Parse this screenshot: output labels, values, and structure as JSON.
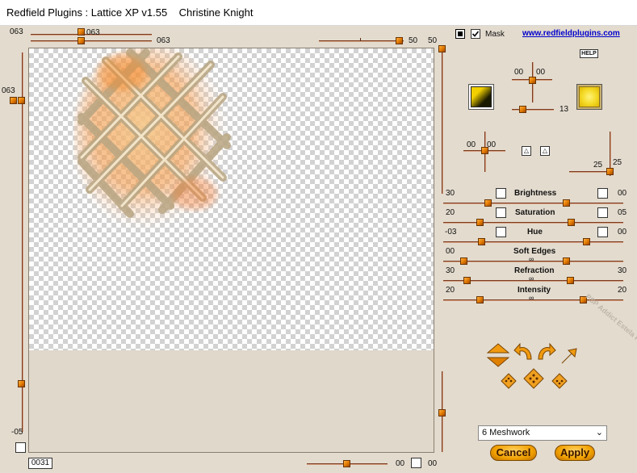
{
  "window": {
    "title": "Redfield Plugins : Lattice XP v1.55    Christine Knight"
  },
  "top_sliders": {
    "left_label": "063",
    "upper_knob_label": "063",
    "lower_value": "063",
    "right_value_a": "50",
    "right_value_b": "50"
  },
  "left_slider": {
    "top_value": "063",
    "bottom_value": "-05"
  },
  "mask": {
    "label": "Mask",
    "checked": true
  },
  "link": "www.redfieldplugins.com",
  "help_label": "HELP",
  "light": {
    "cross_top": "00",
    "cross_right": "00",
    "slider_value": "13"
  },
  "bevel": {
    "cross_value_top": "00",
    "cross_value_left": "00",
    "value_a": "25",
    "value_b": "25"
  },
  "adjustments": [
    {
      "name": "Brightness",
      "left": "30",
      "right": "00"
    },
    {
      "name": "Saturation",
      "left": "20",
      "right": "05"
    },
    {
      "name": "Hue",
      "left": "-03",
      "right": "00"
    },
    {
      "name": "Soft Edges",
      "left": "00",
      "right": ""
    },
    {
      "name": "Refraction",
      "left": "30",
      "right": "30"
    },
    {
      "name": "Intensity",
      "left": "20",
      "right": "20"
    }
  ],
  "preset": {
    "selected": "6 Meshwork"
  },
  "buttons": {
    "cancel": "Cancel",
    "apply": "Apply"
  },
  "bottom": {
    "counter": "0031",
    "zoom_value": "00",
    "zoom_value_b": "00"
  },
  "watermark": "PSP Addict Estela Fonseca",
  "colors": {
    "knob": "#e07800",
    "track": "#7a3a20",
    "swatch_left": "#f2d000",
    "swatch_right": "#f5dc2a"
  }
}
